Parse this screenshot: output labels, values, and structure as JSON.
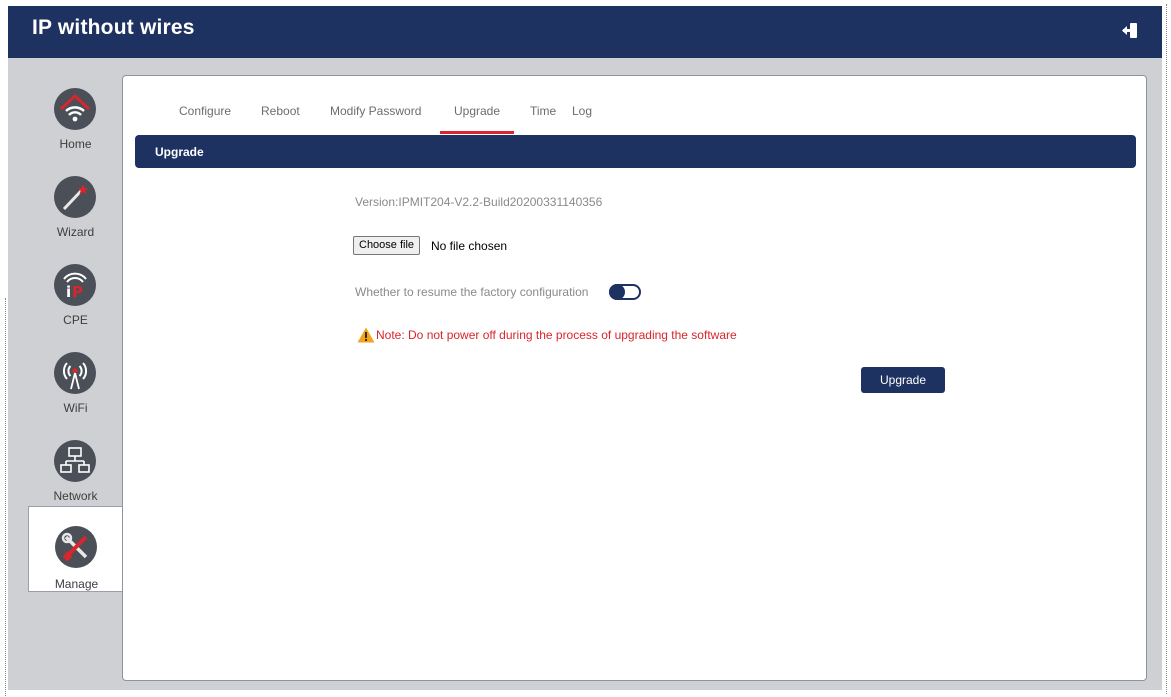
{
  "header": {
    "title": "IP without wires",
    "logout_icon": "logout-icon"
  },
  "sidebar": {
    "items": [
      {
        "label": "Home",
        "icon": "home-wifi-icon"
      },
      {
        "label": "Wizard",
        "icon": "wizard-wand-icon"
      },
      {
        "label": "CPE",
        "icon": "cpe-ip-icon"
      },
      {
        "label": "WiFi",
        "icon": "wifi-tower-icon"
      },
      {
        "label": "Network",
        "icon": "network-icon"
      },
      {
        "label": "Manage",
        "icon": "tools-icon",
        "active": true
      }
    ]
  },
  "tabs": [
    {
      "label": "Configure"
    },
    {
      "label": "Reboot"
    },
    {
      "label": "Modify Password"
    },
    {
      "label": "Upgrade",
      "active": true
    },
    {
      "label": "Time"
    },
    {
      "label": "Log"
    }
  ],
  "section": {
    "title": "Upgrade"
  },
  "upgrade": {
    "version": "Version:IPMIT204-V2.2-Build20200331140356",
    "choose_file_label": "Choose file",
    "file_status": "No file chosen",
    "factory_label": "Whether to resume the factory configuration",
    "factory_toggle_on": false,
    "note": "Note: Do not power off during the process of upgrading the software",
    "button_label": "Upgrade"
  },
  "colors": {
    "brand": "#1e3262",
    "accent": "#d9252b",
    "backdrop": "#cfd0d3",
    "icon_circle": "#4a4f58",
    "warning": "#f2a51c"
  }
}
